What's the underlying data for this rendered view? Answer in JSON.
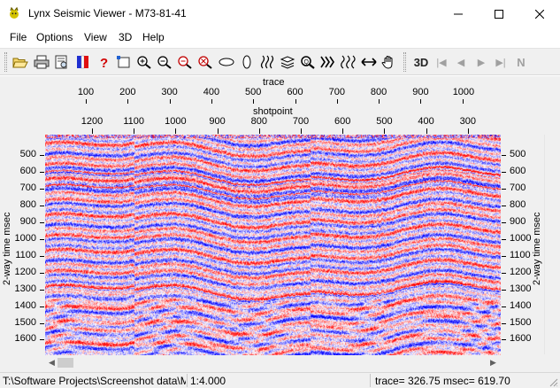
{
  "window": {
    "title": "Lynx Seismic Viewer - M73-81-41",
    "app_icon": "lynx-logo-icon",
    "controls": [
      "minimize-icon",
      "maximize-icon",
      "close-icon"
    ]
  },
  "menu": [
    "File",
    "Options",
    "View",
    "3D",
    "Help"
  ],
  "toolbar": {
    "buttons": [
      "open-folder-icon",
      "print-icon",
      "print-preview-icon",
      "color-palette-icon",
      "help-icon",
      "select-rectangle-icon",
      "zoom-in-icon",
      "zoom-out-icon",
      "zoom-box-icon",
      "zoom-reset-icon",
      "horizontal-squeeze-icon",
      "vertical-squeeze-icon",
      "traces-icon",
      "stack-icon",
      "search-icon",
      "wiggle-icon",
      "wiggle-variable-icon",
      "pan-horizontal-icon",
      "pan-hand-icon"
    ],
    "mode_3d_label": "3D",
    "nav_buttons": [
      "first-icon",
      "previous-icon",
      "next-icon",
      "last-icon"
    ],
    "nav_n_label": "N"
  },
  "axes": {
    "trace_title": "trace",
    "trace_ticks": [
      "100",
      "200",
      "300",
      "400",
      "500",
      "600",
      "700",
      "800",
      "900",
      "1000"
    ],
    "shotpoint_title": "shotpoint",
    "shotpoint_ticks": [
      "1200",
      "1100",
      "1000",
      "900",
      "800",
      "700",
      "600",
      "500",
      "400",
      "300"
    ],
    "y_title": "2-way time msec",
    "y_ticks": [
      "500",
      "600",
      "700",
      "800",
      "900",
      "1000",
      "1100",
      "1200",
      "1300",
      "1400",
      "1500",
      "1600"
    ]
  },
  "seismic": {
    "positive_color": "#0000ff",
    "negative_color": "#ff0000",
    "background": "#ffffff"
  },
  "status": {
    "path": "T:\\Software Projects\\Screenshot data\\M",
    "scale": "1:4.000",
    "readout": "trace=  326.75 msec=   619.70"
  }
}
